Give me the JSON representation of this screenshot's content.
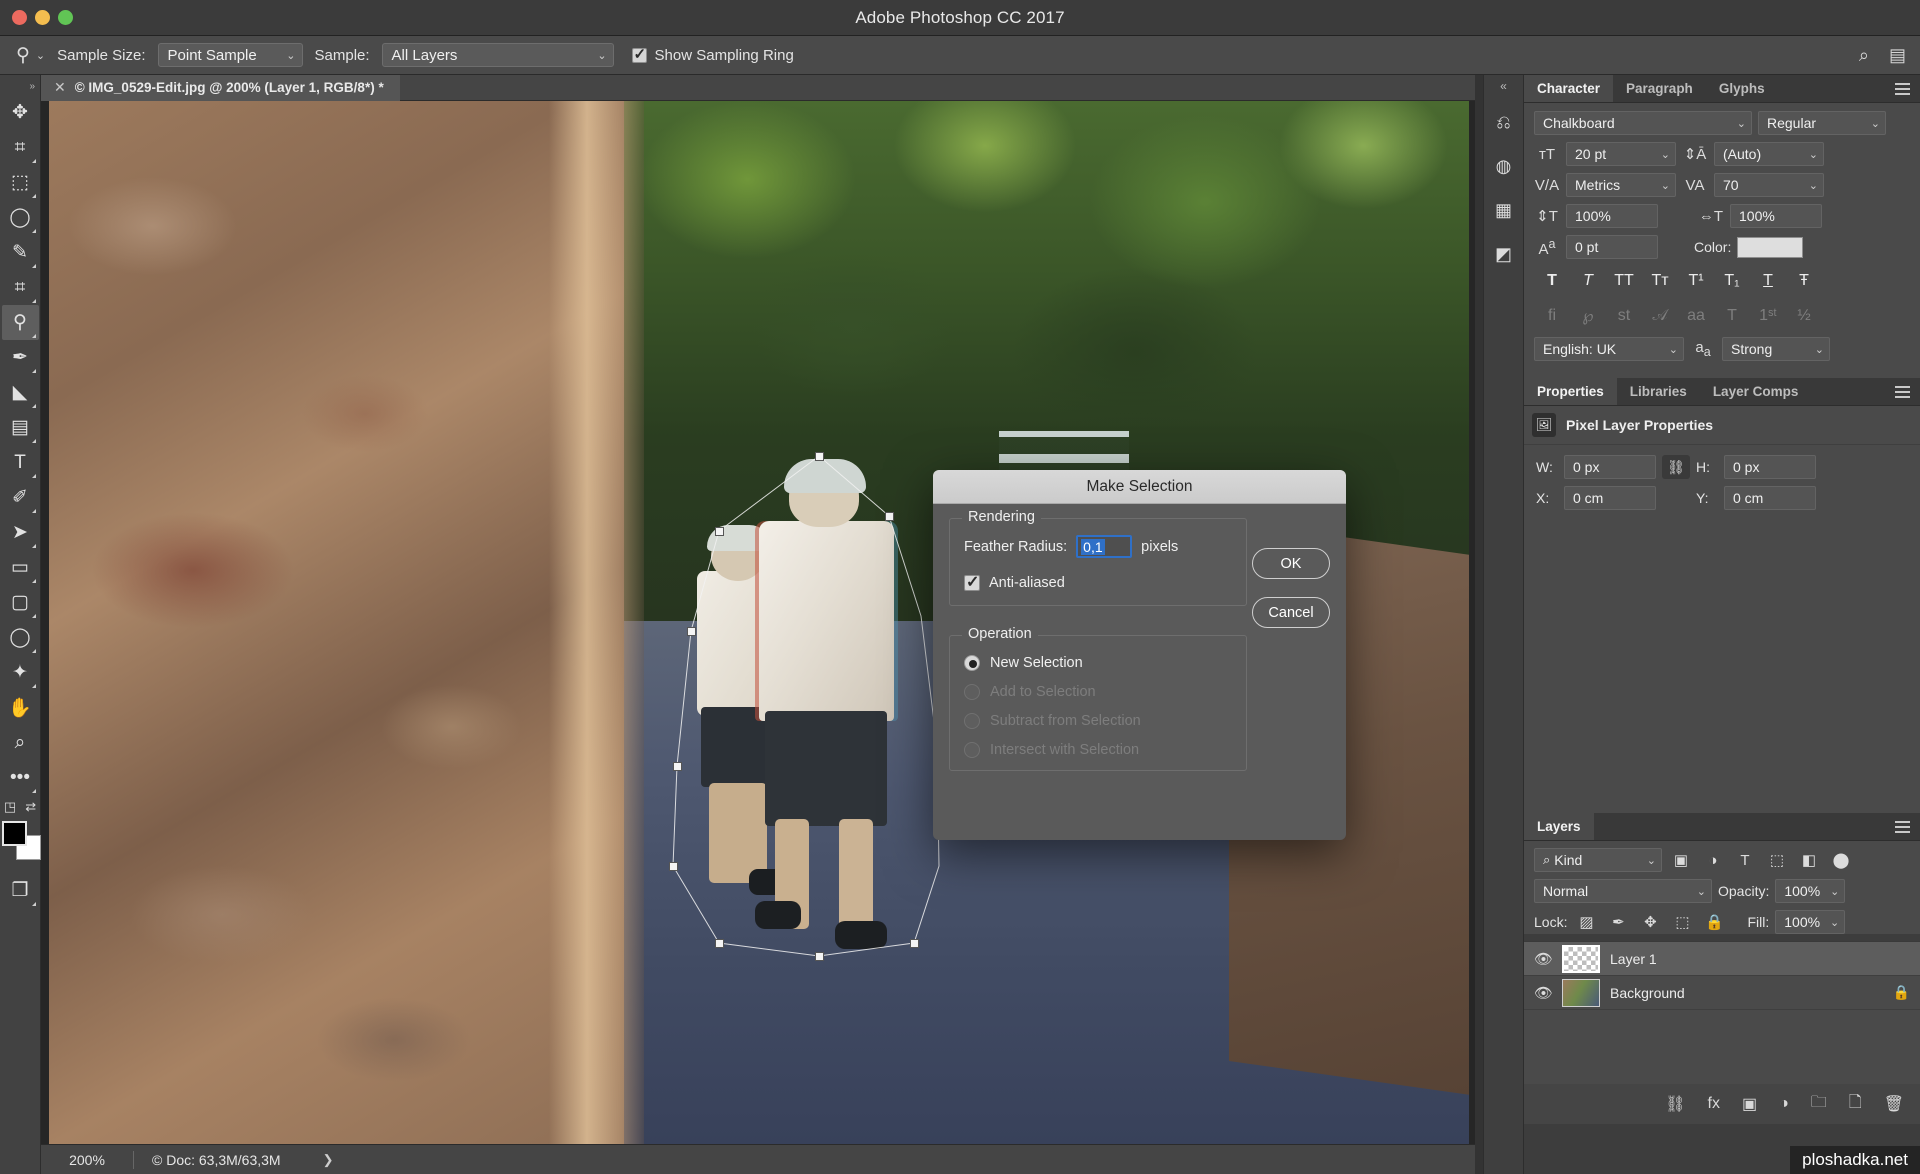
{
  "window": {
    "title": "Adobe Photoshop CC 2017"
  },
  "options_bar": {
    "tool_icon": "eyedropper-icon",
    "sample_size_label": "Sample Size:",
    "sample_size_value": "Point Sample",
    "sample_label": "Sample:",
    "sample_value": "All Layers",
    "show_sampling_ring_label": "Show Sampling Ring",
    "show_sampling_ring_checked": true,
    "search_icon": "search-icon",
    "workspace_icon": "workspace-icon"
  },
  "toolbar": {
    "tools": [
      {
        "name": "move-tool",
        "glyph": "✥",
        "selected": false,
        "has_corner": false
      },
      {
        "name": "artboard-tool",
        "glyph": "⌐",
        "selected": false,
        "has_corner": true
      },
      {
        "name": "marquee-tool",
        "glyph": "▭",
        "selected": false,
        "has_corner": true
      },
      {
        "name": "lasso-tool",
        "glyph": "◯",
        "selected": false,
        "has_corner": true
      },
      {
        "name": "quick-selection-tool",
        "glyph": "✎",
        "selected": false,
        "has_corner": true
      },
      {
        "name": "crop-tool",
        "glyph": "⌗",
        "selected": false,
        "has_corner": true
      },
      {
        "name": "eyedropper-tool",
        "glyph": "⚲",
        "selected": true,
        "has_corner": true
      },
      {
        "name": "brush-tool",
        "glyph": "✒",
        "selected": false,
        "has_corner": true
      },
      {
        "name": "eraser-tool",
        "glyph": "◣",
        "selected": false,
        "has_corner": true
      },
      {
        "name": "gradient-tool",
        "glyph": "▤",
        "selected": false,
        "has_corner": true
      },
      {
        "name": "type-tool",
        "glyph": "T",
        "selected": false,
        "has_corner": true
      },
      {
        "name": "pen-tool",
        "glyph": "✐",
        "selected": false,
        "has_corner": true
      },
      {
        "name": "path-selection-tool",
        "glyph": "➤",
        "selected": false,
        "has_corner": true
      },
      {
        "name": "rectangle-tool",
        "glyph": "▭",
        "selected": false,
        "has_corner": true
      },
      {
        "name": "rounded-rectangle-tool",
        "glyph": "▢",
        "selected": false,
        "has_corner": true
      },
      {
        "name": "ellipse-tool",
        "glyph": "◯",
        "selected": false,
        "has_corner": true
      },
      {
        "name": "custom-shape-tool",
        "glyph": "✦",
        "selected": false,
        "has_corner": true
      },
      {
        "name": "hand-tool",
        "glyph": "✋",
        "selected": false,
        "has_corner": false
      },
      {
        "name": "zoom-tool",
        "glyph": "⌕",
        "selected": false,
        "has_corner": false
      },
      {
        "name": "edit-toolbar-button",
        "glyph": "•••",
        "selected": false,
        "has_corner": true
      }
    ],
    "quickmask_icon": "quick-mask-icon",
    "swap_colors_icon": "swap-colors-icon",
    "foreground_color": "#000000",
    "background_color": "#ffffff",
    "screen_mode_icon": "screen-mode-icon"
  },
  "document": {
    "tab_title": "© IMG_0529-Edit.jpg @ 200% (Layer 1, RGB/8*) *",
    "close_icon": "close-icon"
  },
  "status_bar": {
    "zoom": "200%",
    "doc_info": "© Doc: 63,3M/63,3M",
    "expand_icon": "chevron-right-icon"
  },
  "rail": {
    "collapse_icon": "collapse-panels-icon",
    "items": [
      {
        "name": "history-panel-icon",
        "glyph": "⎌"
      },
      {
        "name": "color-panel-icon",
        "glyph": "◍"
      },
      {
        "name": "swatches-panel-icon",
        "glyph": "▦"
      },
      {
        "name": "adjustments-panel-icon",
        "glyph": "◩"
      }
    ]
  },
  "character_panel": {
    "tabs": [
      {
        "label": "Character",
        "active": true
      },
      {
        "label": "Paragraph",
        "active": false
      },
      {
        "label": "Glyphs",
        "active": false
      }
    ],
    "font_family": "Chalkboard",
    "font_style": "Regular",
    "font_size": "20 pt",
    "leading": "(Auto)",
    "kerning": "Metrics",
    "tracking": "70",
    "vertical_scale": "100%",
    "horizontal_scale": "100%",
    "baseline_shift": "0 pt",
    "color_label": "Color:",
    "color_value": "#dedede",
    "style_buttons": [
      "T",
      "T",
      "TT",
      "Tᴛ",
      "T¹",
      "T₁",
      "T̲",
      "Ŧ"
    ],
    "opentype_buttons": [
      "fi",
      "℘",
      "st",
      "𝒜",
      "aa⃗",
      "𝕋",
      "1ˢᵗ",
      "½"
    ],
    "language": "English: UK",
    "anti_alias_icon": "anti-alias-icon",
    "anti_alias": "Strong",
    "menu_icon": "panel-menu-icon"
  },
  "properties_panel": {
    "tabs": [
      {
        "label": "Properties",
        "active": true
      },
      {
        "label": "Libraries",
        "active": false
      },
      {
        "label": "Layer Comps",
        "active": false
      }
    ],
    "header_icon": "pixel-layer-icon",
    "header_title": "Pixel Layer Properties",
    "w_label": "W:",
    "w_value": "0 px",
    "h_label": "H:",
    "h_value": "0 px",
    "x_label": "X:",
    "x_value": "0 cm",
    "y_label": "Y:",
    "y_value": "0 cm",
    "link_icon": "link-icon",
    "menu_icon": "panel-menu-icon"
  },
  "layers_panel": {
    "tabs": [
      {
        "label": "Layers",
        "active": true
      }
    ],
    "filter_value": "Kind",
    "filter_icons": [
      {
        "name": "filter-pixel-icon",
        "glyph": "🖼"
      },
      {
        "name": "filter-adjustment-icon",
        "glyph": "◑"
      },
      {
        "name": "filter-type-icon",
        "glyph": "T"
      },
      {
        "name": "filter-shape-icon",
        "glyph": "▣"
      },
      {
        "name": "filter-smart-object-icon",
        "glyph": "◧"
      }
    ],
    "filter_toggle_icon": "filter-toggle-icon",
    "blend_mode": "Normal",
    "opacity_label": "Opacity:",
    "opacity_value": "100%",
    "lock_label": "Lock:",
    "lock_icons": [
      {
        "name": "lock-transparency-icon",
        "glyph": "▨"
      },
      {
        "name": "lock-image-icon",
        "glyph": "✒"
      },
      {
        "name": "lock-position-icon",
        "glyph": "✥"
      },
      {
        "name": "lock-artboard-icon",
        "glyph": "⌗"
      },
      {
        "name": "lock-all-icon",
        "glyph": "🔒"
      }
    ],
    "fill_label": "Fill:",
    "fill_value": "100%",
    "layers": [
      {
        "name": "Layer 1",
        "selected": true,
        "thumb": "checker",
        "locked": false,
        "visible": true
      },
      {
        "name": "Background",
        "selected": false,
        "thumb": "photo",
        "locked": true,
        "visible": true
      }
    ],
    "bottom_icons": [
      {
        "name": "link-layers-icon",
        "glyph": "⛓"
      },
      {
        "name": "layer-style-icon",
        "glyph": "fx"
      },
      {
        "name": "layer-mask-icon",
        "glyph": "▣"
      },
      {
        "name": "new-fill-layer-icon",
        "glyph": "◑"
      },
      {
        "name": "new-group-icon",
        "glyph": "🗀"
      },
      {
        "name": "new-layer-icon",
        "glyph": "🗋"
      },
      {
        "name": "delete-layer-icon",
        "glyph": "🗑"
      }
    ],
    "menu_icon": "panel-menu-icon"
  },
  "dialog": {
    "title": "Make Selection",
    "rendering_group_label": "Rendering",
    "feather_label": "Feather Radius:",
    "feather_value": "0,1",
    "feather_unit": "pixels",
    "anti_aliased_label": "Anti-aliased",
    "anti_aliased_checked": true,
    "operation_group_label": "Operation",
    "operations": [
      {
        "label": "New Selection",
        "selected": true,
        "disabled": false
      },
      {
        "label": "Add to Selection",
        "selected": false,
        "disabled": true
      },
      {
        "label": "Subtract from Selection",
        "selected": false,
        "disabled": true
      },
      {
        "label": "Intersect with Selection",
        "selected": false,
        "disabled": true
      }
    ],
    "ok_label": "OK",
    "cancel_label": "Cancel"
  },
  "watermark": {
    "text": "ploshadka.net"
  }
}
